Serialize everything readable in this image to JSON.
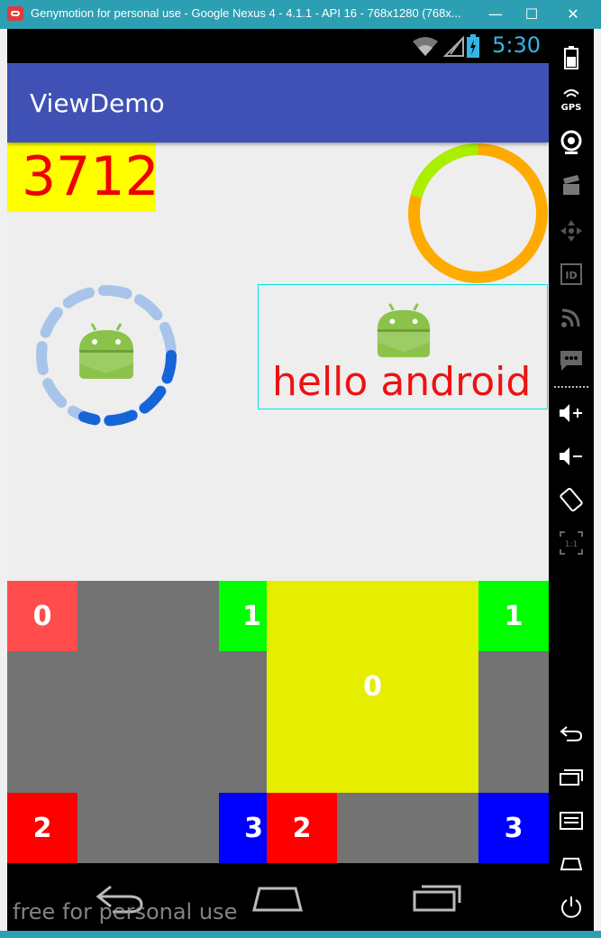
{
  "window": {
    "title": "Genymotion for personal use - Google Nexus 4 - 4.1.1 - API 16 - 768x1280 (768x...",
    "minimize": "—",
    "maximize": "☐",
    "close": "✕"
  },
  "statusbar": {
    "time": "5:30"
  },
  "app": {
    "title": "ViewDemo"
  },
  "content": {
    "counter": "3712",
    "hello_text": "hello android !"
  },
  "grid": {
    "left": {
      "top_left": "0",
      "top_right": "1",
      "bottom_left": "2",
      "bottom_right": "3"
    },
    "right": {
      "top_right": "1",
      "center": "0",
      "bottom_left": "2",
      "bottom_right": "3"
    }
  },
  "navbar": {
    "watermark": "free for personal use"
  },
  "colors": {
    "appbar": "#3f51b5",
    "counter_bg": "#ffff00",
    "counter_text": "#ee0000",
    "ring_green": "#aaee00",
    "ring_orange": "#ffaa00",
    "cell_coral": "#ff4d4d",
    "cell_green": "#00ff00",
    "cell_red": "#ff0000",
    "cell_blue": "#0000ff",
    "cell_yellow": "#e6ee00",
    "grid_bg": "#737373"
  },
  "toolbar": {
    "icons": [
      "battery-icon",
      "gps-icon",
      "camera-icon",
      "video-icon",
      "dpad-icon",
      "id-icon",
      "cast-icon",
      "sms-icon",
      "volume-up-icon",
      "volume-down-icon",
      "rotate-icon",
      "pixel-perfect-icon",
      "back-icon",
      "recent-apps-icon",
      "menu-icon",
      "home-icon",
      "power-icon"
    ],
    "gps_label": "GPS",
    "id_label": "ID",
    "pixel_label": "1:1"
  }
}
